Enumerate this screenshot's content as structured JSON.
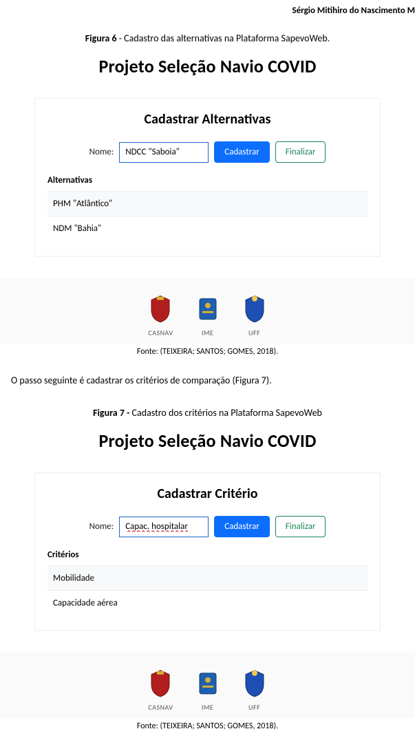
{
  "header": {
    "author": "Sérgio Mitihiro do Nascimento M"
  },
  "figure6": {
    "caption_bold": "Figura 6",
    "caption_rest": " - Cadastro das alternativas na Plataforma SapevoWeb.",
    "project_title": "Projeto Seleção Navio COVID",
    "panel_title": "Cadastrar Alternativas",
    "form": {
      "label": "Nome:",
      "value": "NDCC \"Saboia\"",
      "cadastrar": "Cadastrar",
      "finalizar": "Finalizar"
    },
    "list_header": "Alternativas",
    "items": [
      "PHM \"Atlântico\"",
      "NDM \"Bahia\""
    ],
    "logos": {
      "a": "CASNAV",
      "b": "IME",
      "c": "UFF"
    },
    "source": "Fonte: (TEIXEIRA; SANTOS; GOMES, 2018)."
  },
  "midtext": "O passo seguinte é cadastrar os critérios de comparação (Figura 7).",
  "figure7": {
    "caption_bold": "Figura 7 -",
    "caption_rest": " Cadastro dos critérios na Plataforma SapevoWeb",
    "project_title": "Projeto Seleção Navio COVID",
    "panel_title": "Cadastrar Critério",
    "form": {
      "label": "Nome:",
      "value": "Capac. hospitalar",
      "cadastrar": "Cadastrar",
      "finalizar": "Finalizar"
    },
    "list_header": "Critérios",
    "items": [
      "Mobilidade",
      "Capacidade aérea"
    ],
    "logos": {
      "a": "CASNAV",
      "b": "IME",
      "c": "UFF"
    },
    "source": "Fonte: (TEIXEIRA; SANTOS; GOMES, 2018)."
  }
}
